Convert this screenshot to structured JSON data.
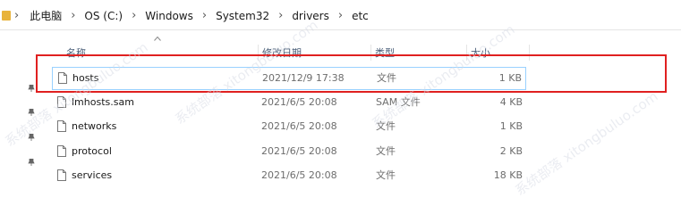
{
  "breadcrumb": {
    "items": [
      "此电脑",
      "OS (C:)",
      "Windows",
      "System32",
      "drivers",
      "etc"
    ]
  },
  "columns": {
    "name": "名称",
    "date": "修改日期",
    "type": "类型",
    "size": "大小"
  },
  "files": [
    {
      "name": "hosts",
      "date": "2021/12/9 17:38",
      "type": "文件",
      "size": "1 KB",
      "selected": true
    },
    {
      "name": "lmhosts.sam",
      "date": "2021/6/5 20:08",
      "type": "SAM 文件",
      "size": "4 KB"
    },
    {
      "name": "networks",
      "date": "2021/6/5 20:08",
      "type": "文件",
      "size": "1 KB"
    },
    {
      "name": "protocol",
      "date": "2021/6/5 20:08",
      "type": "文件",
      "size": "2 KB"
    },
    {
      "name": "services",
      "date": "2021/6/5 20:08",
      "type": "文件",
      "size": "18 KB"
    }
  ],
  "watermark": "系统部落 xitongbuluo.com",
  "colors": {
    "highlight_box": "#e02020",
    "selection_border": "#99d1ff",
    "header_text": "#4c607a",
    "folder": "#e8b33b"
  }
}
